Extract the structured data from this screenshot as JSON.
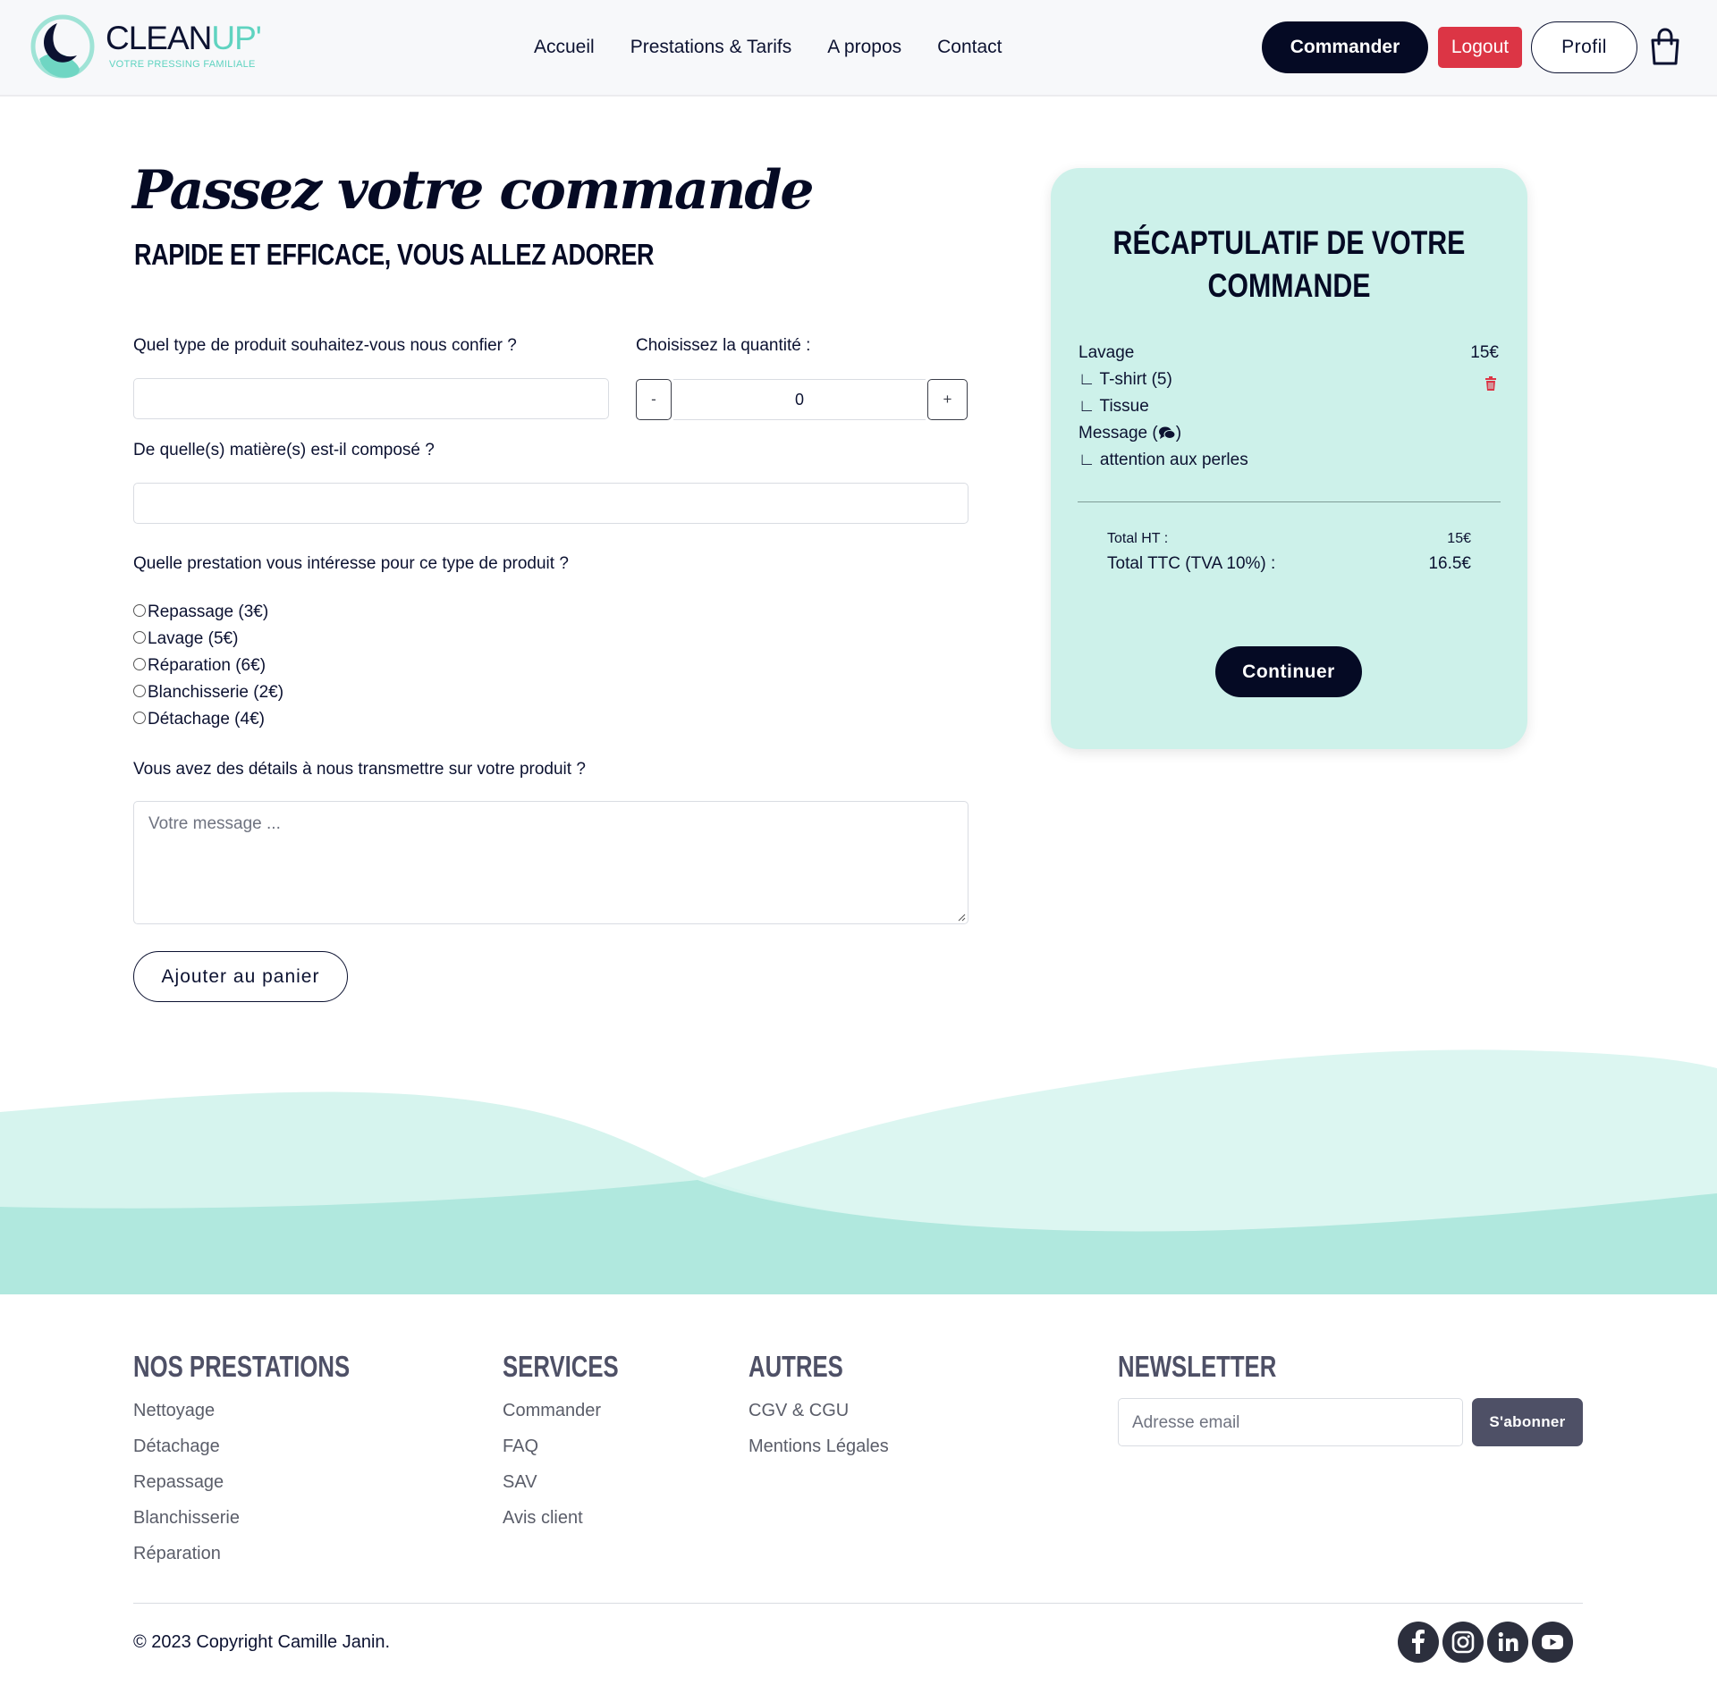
{
  "brand": {
    "name_main": "CLEAN",
    "name_accent": "UP'",
    "tagline": "VOTRE PRESSING FAMILIALE"
  },
  "nav": {
    "items": [
      {
        "label": "Accueil"
      },
      {
        "label": "Prestations & Tarifs"
      },
      {
        "label": "A propos"
      },
      {
        "label": "Contact"
      }
    ],
    "commander_label": "Commander",
    "logout_label": "Logout",
    "profil_label": "Profil",
    "cart_icon": "shopping-bag-icon"
  },
  "hero": {
    "title": "Passez votre commande",
    "subtitle": "RAPIDE ET EFFICACE, VOUS ALLEZ ADORER"
  },
  "form": {
    "product_label": "Quel type de produit souhaitez-vous nous confier ?",
    "product_value": "",
    "quantity_label": "Choisissez la quantité :",
    "quantity_minus": "-",
    "quantity_value": "0",
    "quantity_plus": "+",
    "material_label": "De quelle(s) matière(s) est-il composé ?",
    "material_value": "",
    "service_label": "Quelle prestation vous intéresse pour ce type de produit ?",
    "services": [
      {
        "label": "Repassage (3€)",
        "selected": false
      },
      {
        "label": "Lavage (5€)",
        "selected": false
      },
      {
        "label": "Réparation (6€)",
        "selected": false
      },
      {
        "label": "Blanchisserie (2€)",
        "selected": false
      },
      {
        "label": "Détachage (4€)",
        "selected": false
      }
    ],
    "details_label": "Vous avez des détails à nous transmettre sur votre produit ?",
    "details_placeholder": "Votre message ...",
    "add_to_cart_label": "Ajouter au panier"
  },
  "summary": {
    "title": "RÉCAPTULATIF DE VOTRE COMMANDE",
    "service_name": "Lavage",
    "service_price": "15€",
    "item_line": "∟ T-shirt (5)",
    "material_line": "∟ Tissue",
    "message_label": "Message (",
    "message_close": ")",
    "message_line": "∟ attention aux perles",
    "total_ht_label": "Total HT :",
    "total_ht_value": "15€",
    "total_ttc_label": "Total TTC (TVA 10%) :",
    "total_ttc_value": "16.5€",
    "continue_label": "Continuer",
    "delete_icon": "trash-icon",
    "message_icon": "chat-bubbles-icon"
  },
  "footer": {
    "prestations_title": "NOS PRESTATIONS",
    "prestations": [
      "Nettoyage",
      "Détachage",
      "Repassage",
      "Blanchisserie",
      "Réparation"
    ],
    "services_title": "SERVICES",
    "services": [
      "Commander",
      "FAQ",
      "SAV",
      "Avis client"
    ],
    "autres_title": "AUTRES",
    "autres": [
      "CGV & CGU",
      "Mentions Légales"
    ],
    "newsletter_title": "NEWSLETTER",
    "email_placeholder": "Adresse email",
    "subscribe_label": "S'abonner",
    "copyright": "© 2023 Copyright Camille Janin.",
    "social_icons": [
      "facebook-icon",
      "instagram-icon",
      "linkedin-icon",
      "youtube-icon"
    ]
  },
  "colors": {
    "navy": "#050a24",
    "mint": "#cdf1ea",
    "teal_accent": "#5fd3c0",
    "logout_red": "#dc3545",
    "footer_gray": "#4e5066"
  }
}
